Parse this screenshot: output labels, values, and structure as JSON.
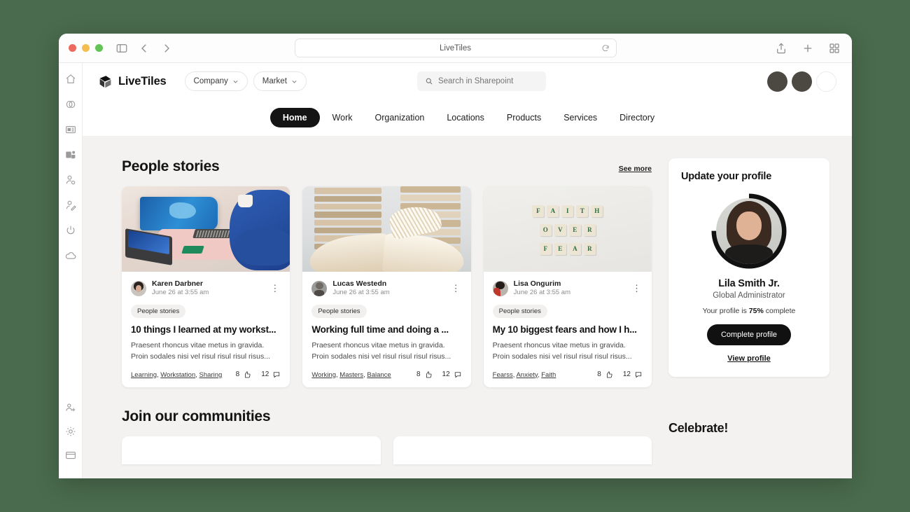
{
  "browser": {
    "url_text": "LiveTiles",
    "traffic_lights": [
      "close",
      "minimize",
      "maximize"
    ],
    "sidebar_toggle_icon": "sidebar-toggle-icon",
    "back_icon": "chevron-left-icon",
    "forward_icon": "chevron-right-icon",
    "reload_icon": "reload-icon",
    "share_icon": "share-icon",
    "new_tab_icon": "plus-icon",
    "tab_overview_icon": "tab-grid-icon"
  },
  "rail": {
    "items": [
      {
        "icon": "home-icon"
      },
      {
        "icon": "links-icon"
      },
      {
        "icon": "news-icon"
      },
      {
        "icon": "teams-icon"
      },
      {
        "icon": "person-search-icon"
      },
      {
        "icon": "person-edit-icon"
      },
      {
        "icon": "power-icon"
      },
      {
        "icon": "cloud-icon"
      }
    ],
    "bottom_items": [
      {
        "icon": "add-people-icon"
      },
      {
        "icon": "gear-icon"
      },
      {
        "icon": "window-icon"
      }
    ]
  },
  "header": {
    "brand_name": "LiveTiles",
    "brand_icon": "livetiles-logo-icon",
    "pills": [
      {
        "label": "Company",
        "icon": "chevron-down-icon"
      },
      {
        "label": "Market",
        "icon": "chevron-down-icon"
      }
    ],
    "search": {
      "placeholder": "Search in Sharepoint",
      "icon": "search-icon"
    },
    "avatars": [
      "dark",
      "dark",
      "empty"
    ]
  },
  "nav": {
    "items": [
      {
        "label": "Home",
        "active": true
      },
      {
        "label": "Work",
        "active": false
      },
      {
        "label": "Organization",
        "active": false
      },
      {
        "label": "Locations",
        "active": false
      },
      {
        "label": "Products",
        "active": false
      },
      {
        "label": "Services",
        "active": false
      },
      {
        "label": "Directory",
        "active": false
      }
    ]
  },
  "people_stories": {
    "title": "People stories",
    "see_more": "See more",
    "cards": [
      {
        "image": "workstation-photo",
        "author": "Karen Darbner",
        "date": "June 26 at 3:55 am",
        "category": "People stories",
        "title": "10 things I learned at my workst...",
        "excerpt": "Praesent rhoncus vitae metus in gravida. Proin sodales nisi vel risul risul risul risus...",
        "tags": [
          "Learning",
          "Workstation",
          "Sharing"
        ],
        "likes": "8",
        "comments": "12",
        "like_icon": "thumbs-up-icon",
        "comment_icon": "comment-icon",
        "menu_icon": "kebab-menu-icon"
      },
      {
        "image": "books-photo",
        "author": "Lucas Westedn",
        "date": "June 26 at 3:55 am",
        "category": "People stories",
        "title": "Working full time and doing a ...",
        "excerpt": "Praesent rhoncus vitae metus in gravida. Proin sodales nisi vel risul risul risul risus...",
        "tags": [
          "Working",
          "Masters",
          "Balance"
        ],
        "likes": "8",
        "comments": "12",
        "like_icon": "thumbs-up-icon",
        "comment_icon": "comment-icon",
        "menu_icon": "kebab-menu-icon"
      },
      {
        "image": "faith-over-fear-photo",
        "author": "Lisa Ongurim",
        "date": "June 26 at 3:55 am",
        "category": "People stories",
        "title": "My 10 biggest fears and how I h...",
        "excerpt": "Praesent rhoncus vitae metus in gravida. Proin sodales nisi vel risul risul risul risus...",
        "tags": [
          "Fearss",
          "Anxiety",
          "Faith"
        ],
        "likes": "8",
        "comments": "12",
        "like_icon": "thumbs-up-icon",
        "comment_icon": "comment-icon",
        "menu_icon": "kebab-menu-icon"
      }
    ]
  },
  "profile_panel": {
    "title": "Update your profile",
    "name": "Lila Smith Jr.",
    "role": "Global Administrator",
    "progress_prefix": "Your profile is ",
    "progress_value": "75%",
    "progress_suffix": " complete",
    "progress_percent": 75,
    "ring_color": "#111111",
    "ring_track_color": "#ffffff",
    "button_label": "Complete profile",
    "link_label": "View profile"
  },
  "communities": {
    "title": "Join our communities"
  },
  "celebrate": {
    "title": "Celebrate!"
  },
  "scrabble": {
    "rows": [
      "FAITH",
      "OVER",
      "FEAR"
    ]
  }
}
